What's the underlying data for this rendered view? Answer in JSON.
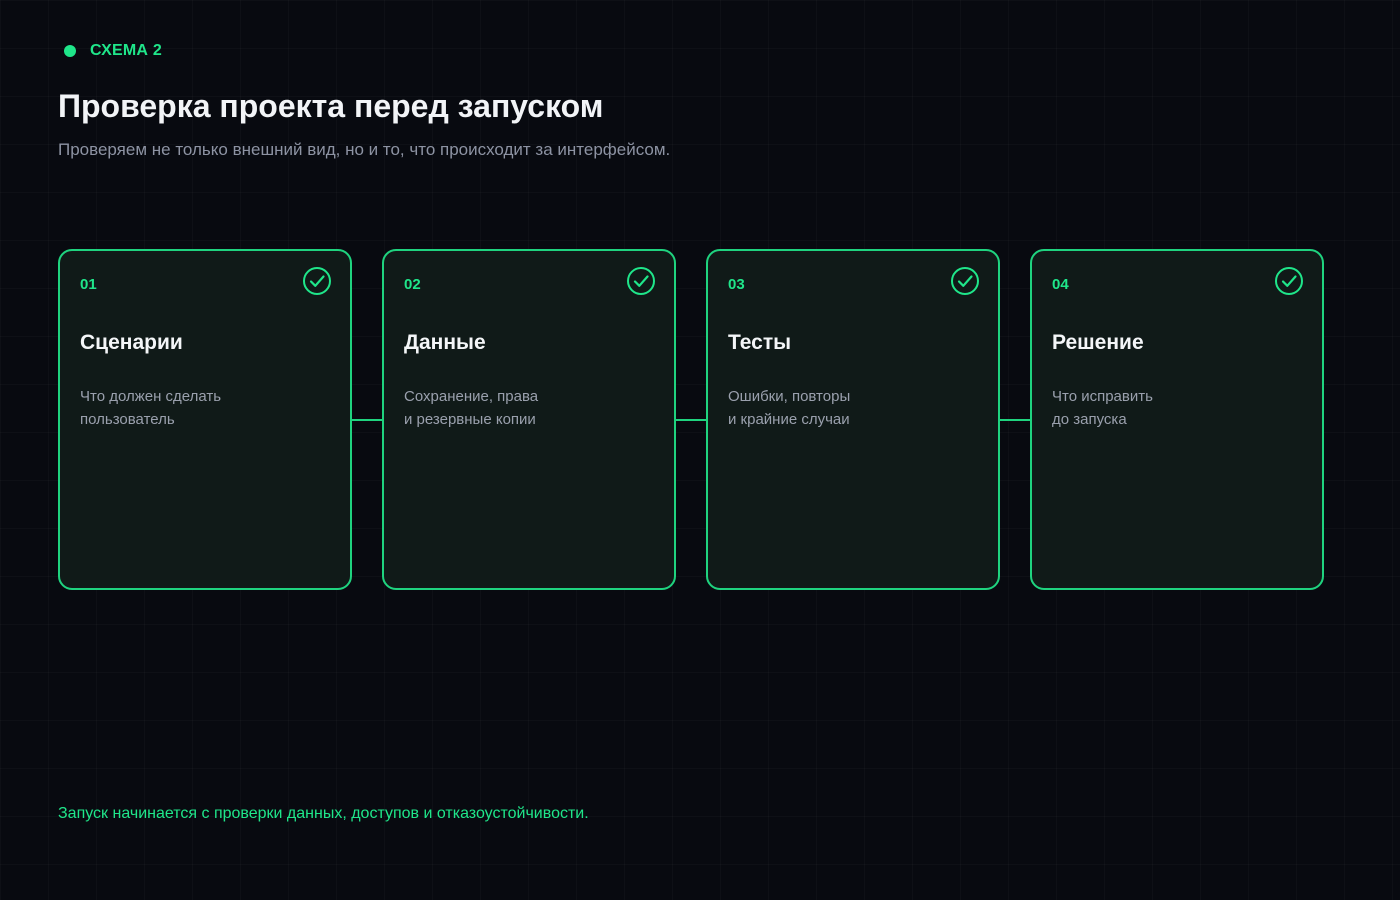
{
  "badge": {
    "label": "СХЕМА 2"
  },
  "header": {
    "title": "Проверка проекта перед запуском",
    "subtitle": "Проверяем не только внешний вид, но и то, что происходит за интерфейсом."
  },
  "steps": [
    {
      "num": "01",
      "title": "Сценарии",
      "desc_line1": "Что должен сделать",
      "desc_line2": "пользователь",
      "icon": "check-circle-icon"
    },
    {
      "num": "02",
      "title": "Данные",
      "desc_line1": "Сохранение, права",
      "desc_line2": "и резервные копии",
      "icon": "check-circle-icon"
    },
    {
      "num": "03",
      "title": "Тесты",
      "desc_line1": "Ошибки, повторы",
      "desc_line2": "и крайние случаи",
      "icon": "check-circle-icon"
    },
    {
      "num": "04",
      "title": "Решение",
      "desc_line1": "Что исправить",
      "desc_line2": "до запуска",
      "icon": "check-circle-icon"
    }
  ],
  "footer": {
    "note": "Запуск начинается с проверки данных, доступов и отказоустойчивости."
  },
  "colors": {
    "accent": "#1fe68a",
    "background": "#080a10",
    "card": "#101a18",
    "text": "#f2f4f7",
    "muted": "#8d93a3"
  }
}
